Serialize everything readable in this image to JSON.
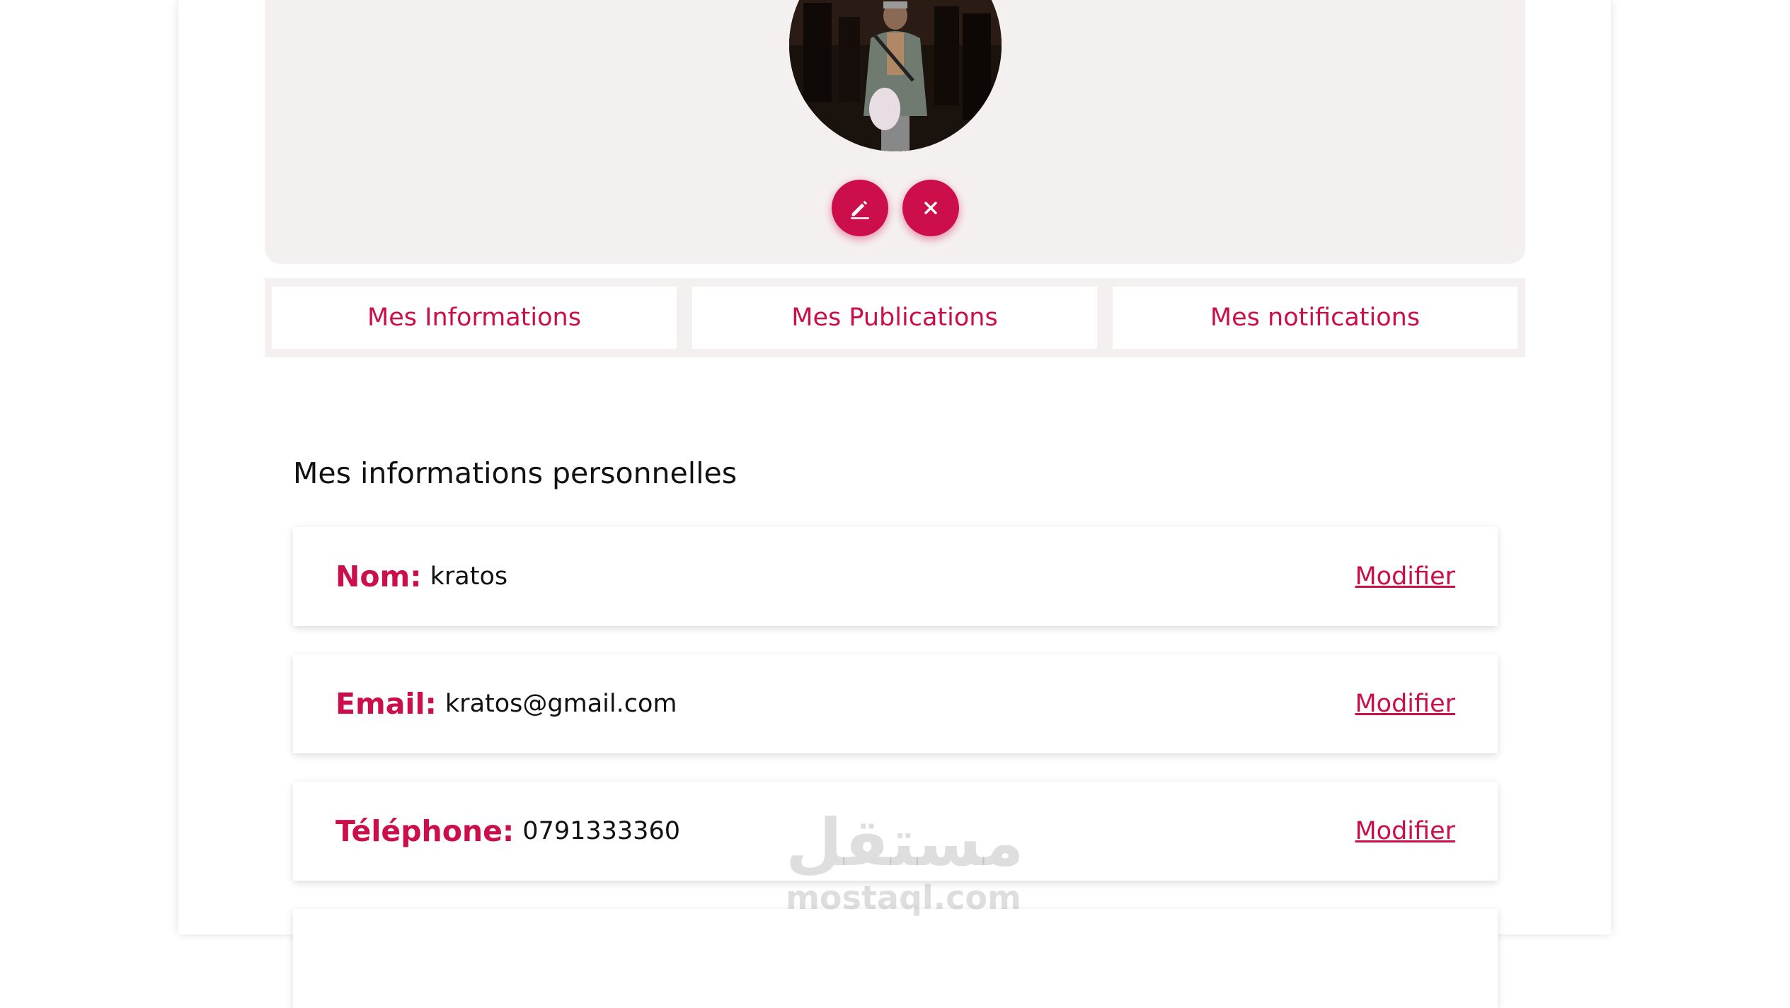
{
  "profile": {
    "avatar_alt": "avatar",
    "edit_icon": "pencil-icon",
    "close_icon": "close-icon"
  },
  "tabs": [
    {
      "label": "Mes Informations"
    },
    {
      "label": "Mes Publications"
    },
    {
      "label": "Mes notifications"
    }
  ],
  "section": {
    "title": "Mes informations personnelles"
  },
  "fields": [
    {
      "label": "Nom:",
      "value": "kratos",
      "action": "Modifier"
    },
    {
      "label": "Email:",
      "value": "kratos@gmail.com",
      "action": "Modifier"
    },
    {
      "label": "Téléphone:",
      "value": "0791333360",
      "action": "Modifier"
    }
  ],
  "watermark": {
    "arabic": "مستقل",
    "latin": "mostaql.com"
  },
  "colors": {
    "accent": "#cc0e4a",
    "header_bg": "#f5f0f0"
  }
}
